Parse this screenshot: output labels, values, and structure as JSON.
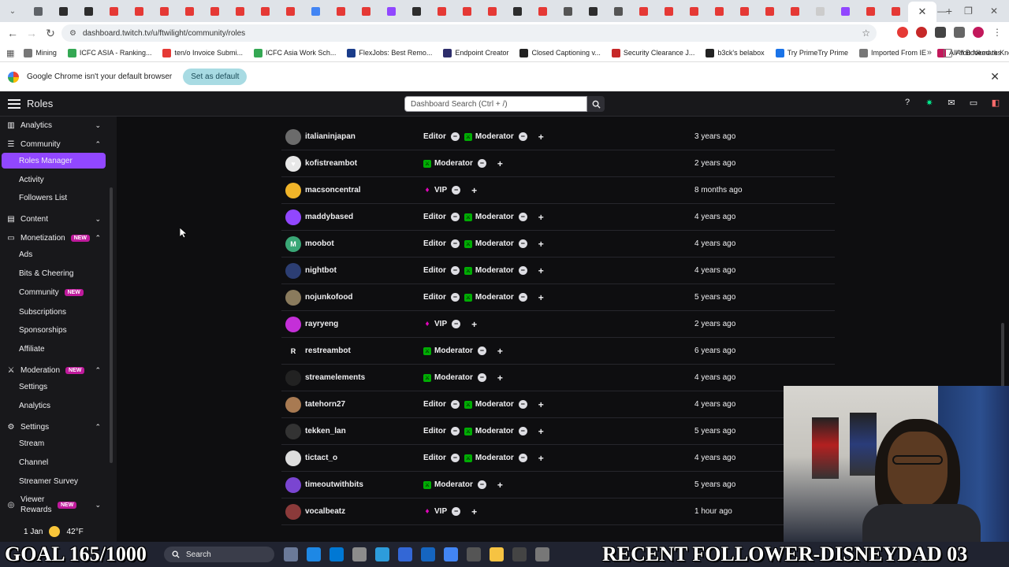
{
  "browser": {
    "tab_favicons": [
      "#5f6368",
      "#2d2d2d",
      "#2d2d2d",
      "#e53935",
      "#e53935",
      "#e53935",
      "#e53935",
      "#e53935",
      "#e53935",
      "#e53935",
      "#e53935",
      "#4285f4",
      "#e53935",
      "#e53935",
      "#9147ff",
      "#2d2d2d",
      "#e53935",
      "#e53935",
      "#e53935",
      "#2d2d2d",
      "#e53935",
      "#555555",
      "#2d2d2d",
      "#555555",
      "#e53935",
      "#e53935",
      "#e53935",
      "#e53935",
      "#e53935",
      "#e53935",
      "#e53935",
      "#cccccc",
      "#9147ff",
      "#e53935",
      "#e53935"
    ],
    "url": "dashboard.twitch.tv/u/ftwilight/community/roles",
    "bookmarks": [
      {
        "label": "Mining",
        "color": "#777777"
      },
      {
        "label": "ICFC ASIA - Ranking...",
        "color": "#34a853"
      },
      {
        "label": "ten/o Invoice Submi...",
        "color": "#e53935"
      },
      {
        "label": "ICFC Asia Work Sch...",
        "color": "#34a853"
      },
      {
        "label": "FlexJobs: Best Remo...",
        "color": "#1a3c8a"
      },
      {
        "label": "Endpoint Creator",
        "color": "#2d2d6b"
      },
      {
        "label": "Closed Captioning v...",
        "color": "#222222"
      },
      {
        "label": "Security Clearance J...",
        "color": "#c62828"
      },
      {
        "label": "b3ck's belabox",
        "color": "#222222"
      },
      {
        "label": "Try PrimeTry Prime",
        "color": "#1a73e8"
      },
      {
        "label": "Imported From IE",
        "color": "#777777"
      },
      {
        "label": "All You Need to Kno...",
        "color": "#c2185b"
      }
    ],
    "all_bookmarks": "All Bookmarks",
    "notice_text": "Google Chrome isn't your default browser",
    "notice_button": "Set as default"
  },
  "topnav": {
    "title": "Roles",
    "search_placeholder": "Dashboard Search (Ctrl + /)"
  },
  "sidebar": {
    "sections": [
      {
        "label": "Analytics",
        "icon": "chart-icon",
        "chevron": "down",
        "badge": ""
      },
      {
        "label": "Community",
        "icon": "community-icon",
        "chevron": "up",
        "badge": ""
      },
      {
        "label": "Content",
        "icon": "content-icon",
        "chevron": "down",
        "badge": ""
      },
      {
        "label": "Monetization",
        "icon": "monetization-icon",
        "chevron": "up",
        "badge": "NEW"
      },
      {
        "label": "Moderation",
        "icon": "sword-icon",
        "chevron": "up",
        "badge": "NEW"
      },
      {
        "label": "Settings",
        "icon": "gear-icon",
        "chevron": "up",
        "badge": ""
      },
      {
        "label": "Viewer Rewards",
        "icon": "reward-icon",
        "chevron": "down",
        "badge": "NEW"
      }
    ],
    "items": [
      {
        "label": "Roles Manager",
        "active": true,
        "badge": ""
      },
      {
        "label": "Activity",
        "active": false,
        "badge": ""
      },
      {
        "label": "Followers List",
        "active": false,
        "badge": ""
      },
      {
        "label": "Ads",
        "active": false,
        "badge": ""
      },
      {
        "label": "Bits & Cheering",
        "active": false,
        "badge": ""
      },
      {
        "label": "Community",
        "active": false,
        "badge": "NEW"
      },
      {
        "label": "Subscriptions",
        "active": false,
        "badge": ""
      },
      {
        "label": "Sponsorships",
        "active": false,
        "badge": ""
      },
      {
        "label": "Affiliate",
        "active": false,
        "badge": ""
      },
      {
        "label": "Settings",
        "active": false,
        "badge": ""
      },
      {
        "label": "Analytics",
        "active": false,
        "badge": ""
      },
      {
        "label": "Stream",
        "active": false,
        "badge": ""
      },
      {
        "label": "Channel",
        "active": false,
        "badge": ""
      },
      {
        "label": "Streamer Survey",
        "active": false,
        "badge": ""
      }
    ]
  },
  "roles_table": [
    {
      "username": "italianinjapan",
      "roles": [
        "Editor",
        "Moderator"
      ],
      "added": "3 years ago",
      "avatar_color": "#6b6b6b",
      "avatar_text": ""
    },
    {
      "username": "kofistreambot",
      "roles": [
        "Moderator"
      ],
      "added": "2 years ago",
      "avatar_color": "#e8e8e8",
      "avatar_text": "♥"
    },
    {
      "username": "macsoncentral",
      "roles": [
        "VIP"
      ],
      "added": "8 months ago",
      "avatar_color": "#f0b429",
      "avatar_text": ""
    },
    {
      "username": "maddybased",
      "roles": [
        "Editor",
        "Moderator"
      ],
      "added": "4 years ago",
      "avatar_color": "#9147ff",
      "avatar_text": ""
    },
    {
      "username": "moobot",
      "roles": [
        "Editor",
        "Moderator"
      ],
      "added": "4 years ago",
      "avatar_color": "#3aa776",
      "avatar_text": "M"
    },
    {
      "username": "nightbot",
      "roles": [
        "Editor",
        "Moderator"
      ],
      "added": "4 years ago",
      "avatar_color": "#2c3e73",
      "avatar_text": ""
    },
    {
      "username": "nojunkofood",
      "roles": [
        "Editor",
        "Moderator"
      ],
      "added": "5 years ago",
      "avatar_color": "#8a7b5d",
      "avatar_text": ""
    },
    {
      "username": "rayryeng",
      "roles": [
        "VIP"
      ],
      "added": "2 years ago",
      "avatar_color": "#c42fd8",
      "avatar_text": ""
    },
    {
      "username": "restreambot",
      "roles": [
        "Moderator"
      ],
      "added": "6 years ago",
      "avatar_color": "#0e0e10",
      "avatar_text": "R"
    },
    {
      "username": "streamelements",
      "roles": [
        "Moderator"
      ],
      "added": "4 years ago",
      "avatar_color": "#222222",
      "avatar_text": ""
    },
    {
      "username": "tatehorn27",
      "roles": [
        "Editor",
        "Moderator"
      ],
      "added": "4 years ago",
      "avatar_color": "#a87a52",
      "avatar_text": ""
    },
    {
      "username": "tekken_lan",
      "roles": [
        "Editor",
        "Moderator"
      ],
      "added": "5 years ago",
      "avatar_color": "#333333",
      "avatar_text": ""
    },
    {
      "username": "tictact_o",
      "roles": [
        "Editor",
        "Moderator"
      ],
      "added": "4 years ago",
      "avatar_color": "#dddddd",
      "avatar_text": ""
    },
    {
      "username": "timeoutwithbits",
      "roles": [
        "Moderator"
      ],
      "added": "5 years ago",
      "avatar_color": "#7a45d1",
      "avatar_text": ""
    },
    {
      "username": "vocalbeatz",
      "roles": [
        "VIP"
      ],
      "added": "1 hour ago",
      "avatar_color": "#8b3a3a",
      "avatar_text": ""
    }
  ],
  "role_colors": {
    "Moderator": "#00ad03",
    "VIP": "#e005b9",
    "Editor": ""
  },
  "weather": {
    "date": "1 Jan",
    "temp": "42°F"
  },
  "stream_overlay": {
    "goal_text": "GOAL 165/1000",
    "follower_text": "RECENT FOLLOWER-DISNEYDAD 03"
  },
  "taskbar": {
    "search_label": "Search"
  }
}
